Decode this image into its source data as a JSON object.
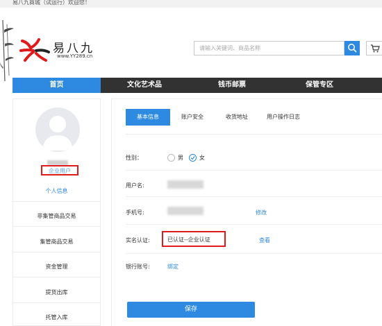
{
  "topbar": {
    "welcome": "易八九商城（试运行）欢迎您！"
  },
  "logo": {
    "name": "易八九",
    "url": "www.YY289.cn"
  },
  "search": {
    "placeholder": "请输入关键词、商品名称",
    "value": ""
  },
  "nav": {
    "items": [
      {
        "label": "首页",
        "active": true
      },
      {
        "label": "文化艺术品",
        "active": false
      },
      {
        "label": "钱币邮票",
        "active": false
      },
      {
        "label": "保管专区",
        "active": false
      }
    ]
  },
  "sidebar": {
    "user_type": "企业用户",
    "items": [
      {
        "label": "个人信息",
        "active": true
      },
      {
        "label": "非集管商品交易",
        "active": false
      },
      {
        "label": "集管商品交易",
        "active": false
      },
      {
        "label": "资金管理",
        "active": false
      },
      {
        "label": "提货出库",
        "active": false
      },
      {
        "label": "托管入库",
        "active": false
      }
    ]
  },
  "tabs": [
    {
      "label": "基本信息",
      "active": true
    },
    {
      "label": "账户安全",
      "active": false
    },
    {
      "label": "收货地址",
      "active": false
    },
    {
      "label": "用户操作日志",
      "active": false
    }
  ],
  "form": {
    "gender": {
      "label": "性别：",
      "options": [
        "男",
        "女"
      ],
      "selected": "女"
    },
    "username": {
      "label": "用户名:"
    },
    "phone": {
      "label": "手机号:",
      "action": "修改"
    },
    "realname": {
      "label": "实名认证:",
      "value": "已认证--企业认证",
      "action": "查看"
    },
    "bank": {
      "label": "银行账号:",
      "action": "绑定"
    },
    "save": "保存"
  },
  "colors": {
    "accent": "#2d8ae0",
    "nav_bg": "#323232",
    "highlight": "#e0191b"
  }
}
